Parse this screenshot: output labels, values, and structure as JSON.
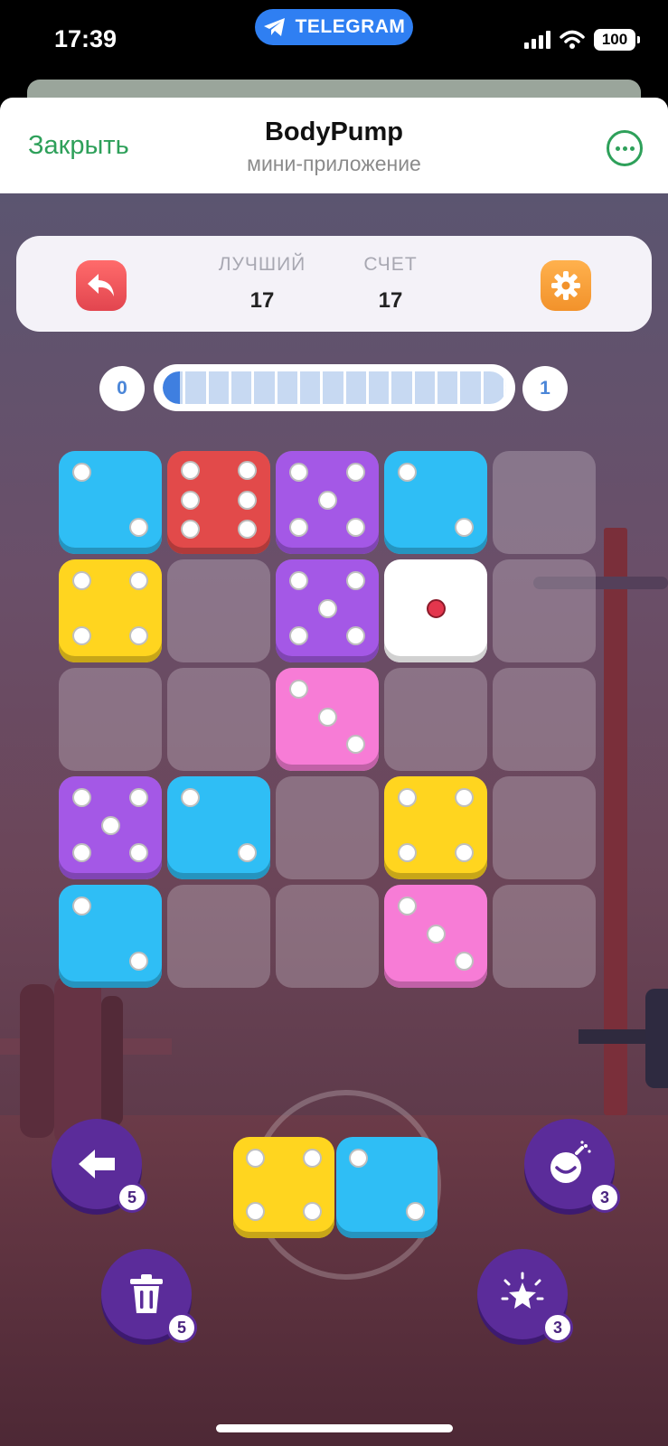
{
  "status_bar": {
    "time": "17:39",
    "pill_label": "TELEGRAM",
    "battery": "100"
  },
  "header": {
    "close_label": "Закрыть",
    "title": "BodyPump",
    "subtitle": "мини-приложение"
  },
  "score": {
    "best_label": "ЛУЧШИЙ",
    "best_value": "17",
    "current_label": "СЧЕТ",
    "current_value": "17"
  },
  "progress": {
    "level_from": "0",
    "level_to": "1",
    "fill_fraction": 0.05,
    "segments": 15
  },
  "colors": {
    "blue": "#2fbef5",
    "red": "#e24a4a",
    "purple": "#a458e6",
    "yellow": "#ffd51f",
    "white": "#ffffff",
    "pink": "#f77cd6"
  },
  "board": {
    "rows": 5,
    "cols": 5,
    "dice": [
      {
        "row": 0,
        "col": 0,
        "color": "blue",
        "value": 2
      },
      {
        "row": 0,
        "col": 1,
        "color": "red",
        "value": 6
      },
      {
        "row": 0,
        "col": 2,
        "color": "purple",
        "value": 5
      },
      {
        "row": 0,
        "col": 3,
        "color": "blue",
        "value": 2
      },
      {
        "row": 1,
        "col": 0,
        "color": "yellow",
        "value": 4
      },
      {
        "row": 1,
        "col": 2,
        "color": "purple",
        "value": 5
      },
      {
        "row": 1,
        "col": 3,
        "color": "white",
        "value": 1
      },
      {
        "row": 2,
        "col": 2,
        "color": "pink",
        "value": 3
      },
      {
        "row": 3,
        "col": 0,
        "color": "purple",
        "value": 5
      },
      {
        "row": 3,
        "col": 1,
        "color": "blue",
        "value": 2
      },
      {
        "row": 3,
        "col": 3,
        "color": "yellow",
        "value": 4
      },
      {
        "row": 4,
        "col": 0,
        "color": "blue",
        "value": 2
      },
      {
        "row": 4,
        "col": 3,
        "color": "pink",
        "value": 3
      }
    ]
  },
  "active_piece": [
    {
      "color": "yellow",
      "value": 4
    },
    {
      "color": "blue",
      "value": 2
    }
  ],
  "tools": [
    {
      "name": "undo",
      "icon": "arrow-left-icon",
      "count": "5"
    },
    {
      "name": "bomb",
      "icon": "bomb-icon",
      "count": "3"
    },
    {
      "name": "trash",
      "icon": "trash-icon",
      "count": "5"
    },
    {
      "name": "star",
      "icon": "star-burst-icon",
      "count": "3"
    }
  ]
}
